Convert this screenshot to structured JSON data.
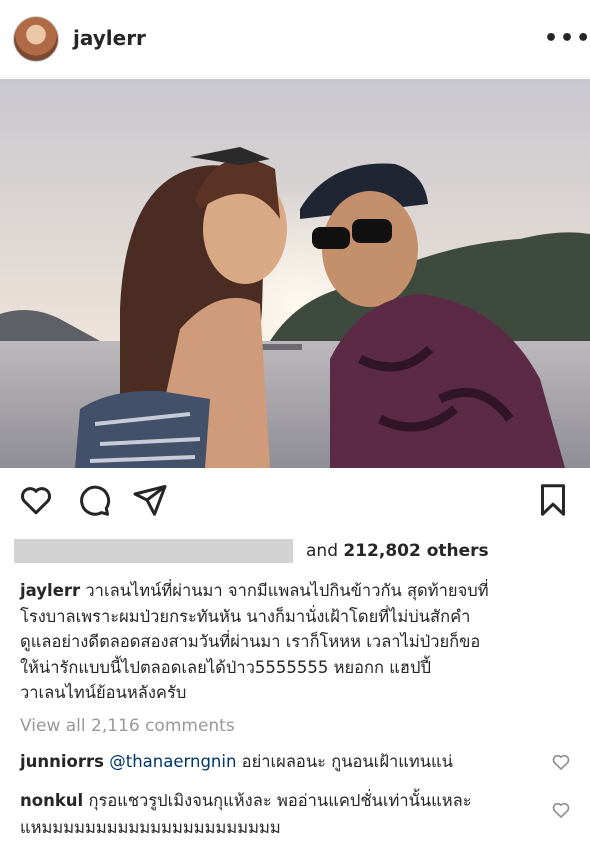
{
  "post": {
    "username": "jaylerr",
    "more_label": "•••"
  },
  "photo": {
    "alt": ""
  },
  "icons": {
    "like": "heart-icon",
    "comment": "comment-icon",
    "share": "send-icon",
    "save": "bookmark-icon",
    "comment_like": "heart-outline-icon"
  },
  "likes": {
    "prefix": "and ",
    "count": "212,802 others"
  },
  "caption": {
    "username": "jaylerr",
    "text": " วาเลนไทน์ที่ผ่านมา จากมีแพลนไปกินข้าวกัน สุดท้ายจบที่\nโรงบาลเพราะผมป่วยกระทันหัน นางก็มานั่งเฝ้าโดยที่ไม่บ่นสักคำ\nดูแลอย่างดีตลอดสองสามวันที่ผ่านมา เราก็โหหห เวลาไม่ป่วยก็ขอ\nให้น่ารักแบบนี้ไปตลอดเลยได้ป่าว5555555 หยอกก แฮปปี้\nวาเลนไทน์ย้อนหลังครับ"
  },
  "view_all_comments": "View all 2,116 comments",
  "comments": [
    {
      "username": "junniorrs",
      "mention": "@thanaerngnin",
      "text": " อย่าเผลอนะ กูนอนเฝ้าแทนแน่"
    },
    {
      "username": "nonkul",
      "text": " กุรอแชวรูปเมิงจนกุแห้งละ พออ่านแคปชั่นเท่านั้นแหละ\nแหมมมมมมมมมมมมมมมมมมมมมม"
    }
  ],
  "colors": {
    "text": "#262626",
    "muted": "#999999",
    "mention": "#00376b",
    "redacted": "#d3d3d3"
  }
}
